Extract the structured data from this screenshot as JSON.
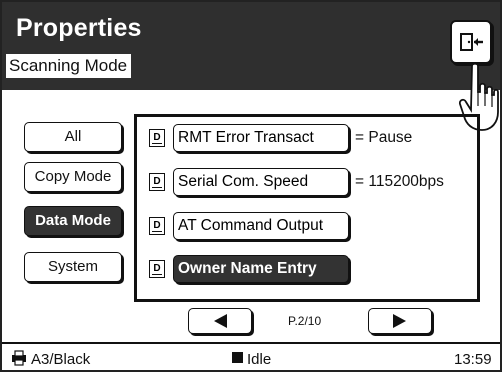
{
  "header": {
    "title": "Properties",
    "subtitle": "Scanning Mode",
    "exit_icon": "exit-door-icon"
  },
  "modes": [
    {
      "label": "All",
      "active": false
    },
    {
      "label": "Copy Mode",
      "active": false
    },
    {
      "label": "Data Mode",
      "active": true
    },
    {
      "label": "System",
      "active": false
    }
  ],
  "items": [
    {
      "label": "RMT Error Transact",
      "value": "= Pause",
      "active": false
    },
    {
      "label": "Serial Com. Speed",
      "value": "= 115200bps",
      "active": false
    },
    {
      "label": "AT Command Output",
      "value": "",
      "active": false
    },
    {
      "label": "Owner Name Entry",
      "value": "",
      "active": true
    }
  ],
  "item_icon_letter": "D",
  "pagination": {
    "page": "P.2/10",
    "prev_icon": "left-triangle-icon",
    "next_icon": "right-triangle-icon"
  },
  "status": {
    "paper": "A3/Black",
    "state": "Idle",
    "time": "13:59"
  }
}
